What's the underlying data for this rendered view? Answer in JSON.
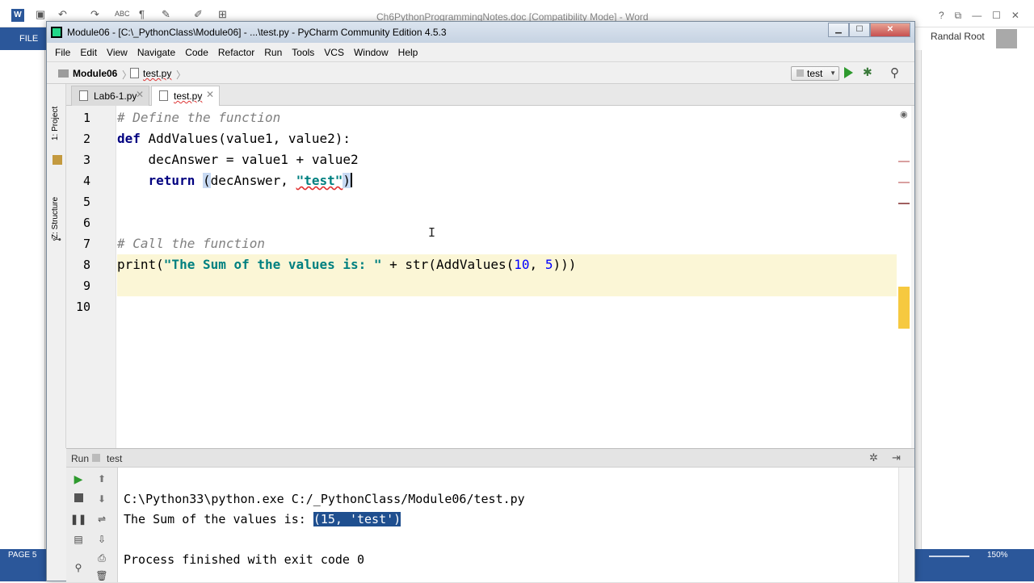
{
  "word": {
    "doc_title": "Ch6PythonProgrammingNotes.doc [Compatibility Mode] - Word",
    "file_tab": "FILE",
    "user_name": "Randal Root",
    "status_page": "PAGE 5",
    "zoom": "150%"
  },
  "window": {
    "title": "Module06 - [C:\\_PythonClass\\Module06] - ...\\test.py - PyCharm Community Edition 4.5.3"
  },
  "menu": [
    "File",
    "Edit",
    "View",
    "Navigate",
    "Code",
    "Refactor",
    "Run",
    "Tools",
    "VCS",
    "Window",
    "Help"
  ],
  "navbar": {
    "module": "Module06",
    "file": "test.py",
    "run_config": "test"
  },
  "sidebar": {
    "project_tab": "1: Project",
    "structure_tab": "Z: Structure"
  },
  "tabs": [
    {
      "label": "Lab6-1.py",
      "active": false
    },
    {
      "label": "test.py",
      "active": true
    }
  ],
  "editor": {
    "line_numbers": [
      "1",
      "2",
      "3",
      "4",
      "5",
      "6",
      "7",
      "8",
      "9",
      "10"
    ],
    "lines": {
      "l1_comment": "# Define the function",
      "l2_kw": "def",
      "l2_rest": " AddValues(value1, value2):",
      "l3": "    decAnswer = value1 + value2",
      "l4_indent": "    ",
      "l4_kw": "return",
      "l4_sp": " ",
      "l4_open": "(",
      "l4_mid": "decAnswer, ",
      "l4_str": "\"test\"",
      "l4_close": ")",
      "l7_comment": "# Call the function",
      "l8_a": "print(",
      "l8_str": "\"The Sum of the values is: \"",
      "l8_b": " + str(AddValues(",
      "l8_n1": "10",
      "l8_c": ", ",
      "l8_n2": "5",
      "l8_d": ")))"
    }
  },
  "run_panel": {
    "label": "Run",
    "config": "test",
    "output": {
      "cmd": "C:\\Python33\\python.exe C:/_PythonClass/Module06/test.py",
      "result_prefix": "The Sum of the values is: ",
      "result_value": "(15, 'test')",
      "exit": "Process finished with exit code 0"
    }
  },
  "colors": {
    "keyword": "#000080",
    "string": "#008080",
    "number": "#0000ff",
    "comment": "#808080",
    "current_line": "#fbf6d6",
    "selection": "#1f4f8f",
    "word_accent": "#2b579a"
  }
}
